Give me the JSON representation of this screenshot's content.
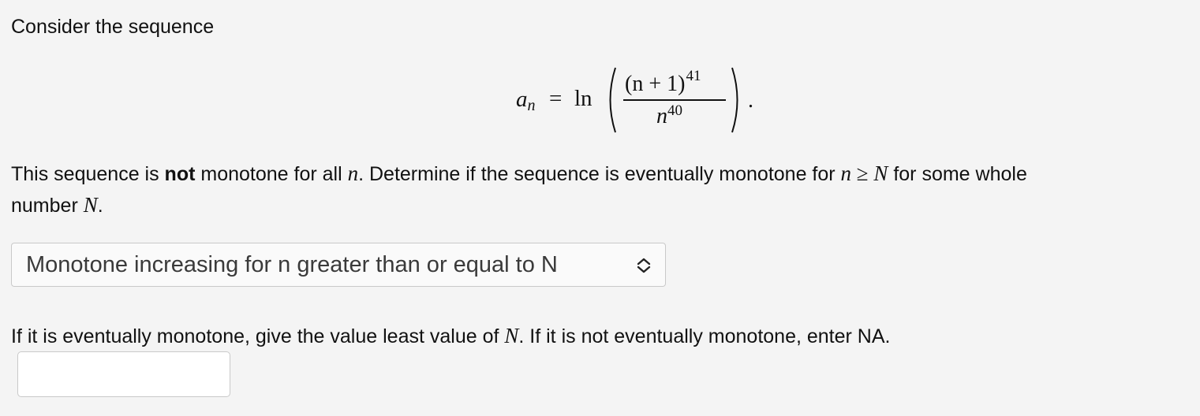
{
  "intro": "Consider the sequence",
  "formula": {
    "lhs_symbol": "a",
    "lhs_subscript": "n",
    "equals": "=",
    "func": "ln",
    "numerator_base": "(n + 1)",
    "numerator_exp": "41",
    "denominator_base": "n",
    "denominator_exp": "40",
    "trailing": "."
  },
  "statement": {
    "part1": "This sequence is ",
    "bold": "not",
    "part2": " monotone for all ",
    "var_n1": "n",
    "part3": ". Determine if the sequence is eventually monotone for ",
    "var_n2": "n",
    "geq": " ≥ ",
    "var_N1": "N",
    "part4": " for some whole",
    "line2_prefix": "number ",
    "var_N2": "N",
    "line2_suffix": "."
  },
  "monotone_select": {
    "selected": "Monotone increasing for n greater than or equal to N",
    "icon": "updown-chevron-icon"
  },
  "question2": {
    "part1": "If it is eventually monotone, give the value least value of ",
    "var_N": "N",
    "part2": ". If it is not eventually monotone, enter NA."
  },
  "answer_input": {
    "value": "",
    "placeholder": ""
  }
}
